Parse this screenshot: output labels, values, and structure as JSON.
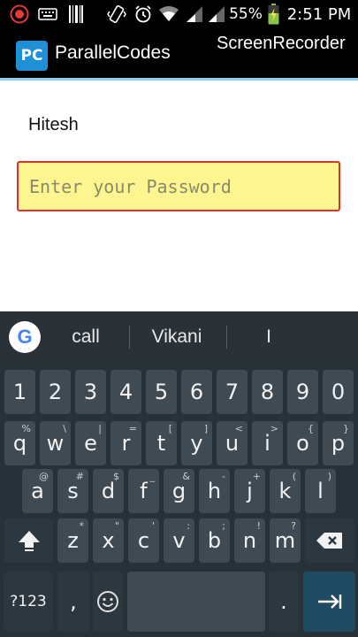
{
  "status": {
    "battery": "55%",
    "time": "2:51 PM"
  },
  "app": {
    "logo": "PC",
    "title": "ParallelCodes",
    "overlay": "ScreenRecorder"
  },
  "form": {
    "username": "Hitesh",
    "password_placeholder": "Enter your Password"
  },
  "keyboard": {
    "logo": "G",
    "suggestions": [
      "call",
      "Vikani",
      "I"
    ],
    "row_numbers": [
      "1",
      "2",
      "3",
      "4",
      "5",
      "6",
      "7",
      "8",
      "9",
      "0"
    ],
    "row1": [
      {
        "k": "q",
        "h": "%"
      },
      {
        "k": "w",
        "h": "\\"
      },
      {
        "k": "e",
        "h": "|"
      },
      {
        "k": "r",
        "h": "="
      },
      {
        "k": "t",
        "h": "["
      },
      {
        "k": "y",
        "h": "]"
      },
      {
        "k": "u",
        "h": "<"
      },
      {
        "k": "i",
        "h": ">"
      },
      {
        "k": "o",
        "h": "{"
      },
      {
        "k": "p",
        "h": "}"
      }
    ],
    "row2": [
      {
        "k": "a",
        "h": "@"
      },
      {
        "k": "s",
        "h": "#"
      },
      {
        "k": "d",
        "h": "$"
      },
      {
        "k": "f",
        "h": "_"
      },
      {
        "k": "g",
        "h": "&"
      },
      {
        "k": "h",
        "h": "-"
      },
      {
        "k": "j",
        "h": "+"
      },
      {
        "k": "k",
        "h": "("
      },
      {
        "k": "l",
        "h": ")"
      }
    ],
    "row3": [
      {
        "k": "z",
        "h": "*"
      },
      {
        "k": "x",
        "h": "\""
      },
      {
        "k": "c",
        "h": "'"
      },
      {
        "k": "v",
        "h": ":"
      },
      {
        "k": "b",
        "h": ";"
      },
      {
        "k": "n",
        "h": "!"
      },
      {
        "k": "m",
        "h": "?"
      }
    ],
    "sym_label": "?123",
    "comma": ",",
    "period": "."
  }
}
